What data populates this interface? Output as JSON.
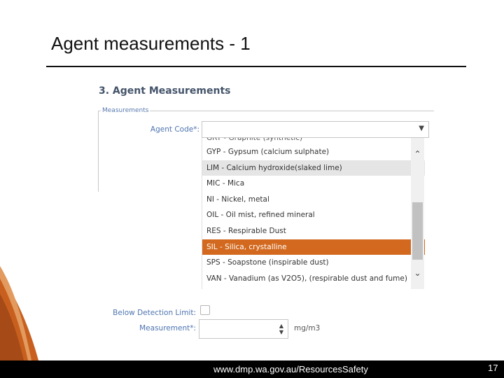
{
  "slide": {
    "title": "Agent measurements - 1",
    "footer_url": "www.dmp.wa.gov.au/ResourcesSafety",
    "page_number": "17"
  },
  "form": {
    "section_heading": "3. Agent Measurements",
    "fieldset_legend": "Measurements",
    "agent_code_label": "Agent Code*:",
    "agent_code_value": "",
    "below_detection_label": "Below Detection Limit:",
    "below_detection_checked": false,
    "measurement_label": "Measurement*:",
    "measurement_value": "",
    "measurement_unit": "mg/m3"
  },
  "dropdown": {
    "partial_top": "GRT - Graphite (synthetic)",
    "options": [
      "GYP - Gypsum (calcium sulphate)",
      "LIM - Calcium hydroxide(slaked lime)",
      "MIC - Mica",
      "NI - Nickel, metal",
      "OIL - Oil mist, refined mineral",
      "RES - Respirable Dust",
      "SIL - Silica, crystalline",
      "SPS - Soapstone (inspirable dust)",
      "VAN - Vanadium (as V2O5), (respirable dust and fume)"
    ],
    "hovered_option": "LIM - Calcium hydroxide(slaked lime)",
    "selected_option": "SIL - Silica, crystalline"
  },
  "icons": {
    "select_arrow": "triangle-down-icon",
    "scroll_up": "chevron-up-icon",
    "scroll_down": "chevron-down-icon",
    "spin_up": "triangle-up-icon",
    "spin_down": "triangle-down-icon"
  },
  "colors": {
    "accent_selected": "#d2691e",
    "label_blue": "#4e74b0",
    "heading": "#44546a",
    "footer_bg": "#000000"
  }
}
